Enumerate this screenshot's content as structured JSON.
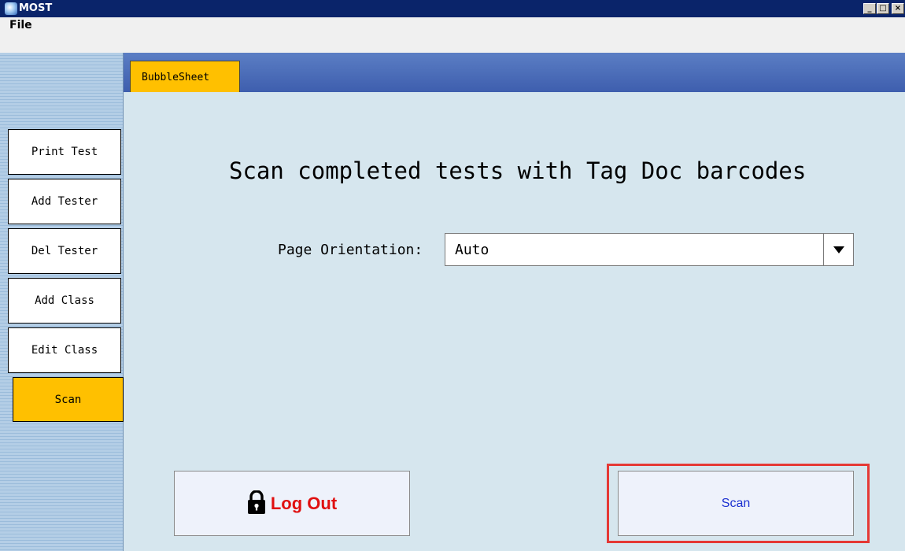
{
  "window": {
    "title": "MOST",
    "controls": {
      "minimize": "_",
      "maximize": "□",
      "close": "×"
    }
  },
  "menu": {
    "file": "File"
  },
  "sidebar": {
    "items": [
      {
        "label": "Print Test",
        "active": false
      },
      {
        "label": "Add Tester",
        "active": false
      },
      {
        "label": "Del Tester",
        "active": false
      },
      {
        "label": "Add Class",
        "active": false
      },
      {
        "label": "Edit Class",
        "active": false
      },
      {
        "label": "Scan",
        "active": true
      }
    ]
  },
  "tabs": [
    {
      "label": "BubbleSheet",
      "active": true
    }
  ],
  "main": {
    "heading": "Scan completed tests with Tag Doc barcodes",
    "orientation_label": "Page Orientation:",
    "orientation_value": "Auto",
    "logout_label": "Log Out",
    "scan_label": "Scan"
  },
  "icons": {
    "app": "app-globe-icon",
    "dropdown": "chevron-down-icon",
    "logout": "lock-icon"
  },
  "colors": {
    "active_yellow": "#ffc000",
    "logout_red": "#e01010",
    "scan_blue": "#1a2fd0",
    "highlight_red": "#e53935",
    "content_bg": "#d6e6ee",
    "tabstrip_blue": "#3e5eae"
  }
}
